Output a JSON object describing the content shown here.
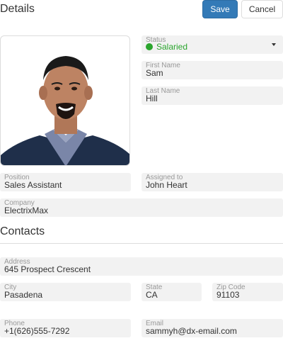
{
  "header": {
    "title": "Details",
    "save_label": "Save",
    "cancel_label": "Cancel"
  },
  "details": {
    "status": {
      "label": "Status",
      "value": "Salaried",
      "color": "#2ba52e"
    },
    "first_name": {
      "label": "First Name",
      "value": "Sam"
    },
    "last_name": {
      "label": "Last Name",
      "value": "Hill"
    },
    "position": {
      "label": "Position",
      "value": "Sales Assistant"
    },
    "assigned_to": {
      "label": "Assigned to",
      "value": "John Heart"
    },
    "company": {
      "label": "Company",
      "value": "ElectrixMax"
    }
  },
  "contacts": {
    "title": "Contacts",
    "address": {
      "label": "Address",
      "value": "645 Prospect Crescent"
    },
    "city": {
      "label": "City",
      "value": "Pasadena"
    },
    "state": {
      "label": "State",
      "value": "CA"
    },
    "zip": {
      "label": "Zip Code",
      "value": "91103"
    },
    "phone": {
      "label": "Phone",
      "value": "+1(626)555-7292"
    },
    "email": {
      "label": "Email",
      "value": "sammyh@dx-email.com"
    }
  },
  "colors": {
    "primary": "#337ab7",
    "field_bg": "#f2f2f2",
    "label": "#999999"
  }
}
